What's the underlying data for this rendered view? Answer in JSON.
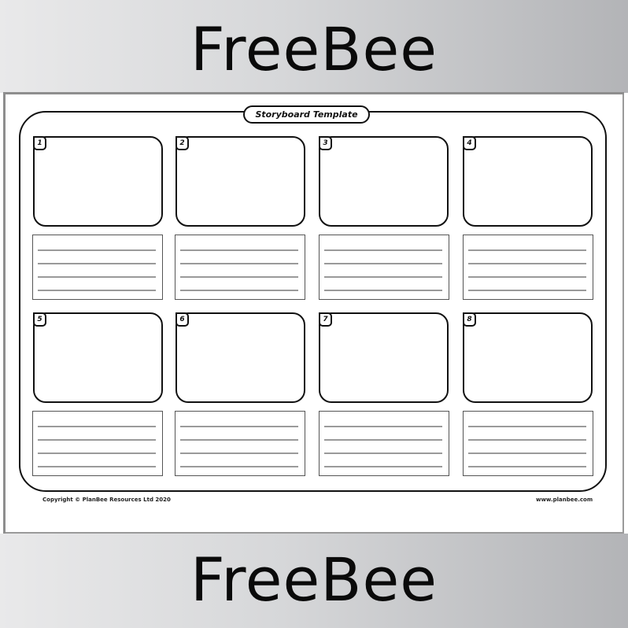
{
  "banner": {
    "top_text": "FreeBee",
    "bottom_text": "FreeBee"
  },
  "worksheet": {
    "title": "Storyboard Template",
    "panels": [
      {
        "number": "1"
      },
      {
        "number": "2"
      },
      {
        "number": "3"
      },
      {
        "number": "4"
      },
      {
        "number": "5"
      },
      {
        "number": "6"
      },
      {
        "number": "7"
      },
      {
        "number": "8"
      }
    ],
    "caption_lines_per_panel": 4,
    "copyright": "Copyright © PlanBee Resources Ltd 2020",
    "website": "www.planbee.com"
  },
  "colors": {
    "ink": "#111111",
    "caption_line": "#9a9a9a",
    "band_light": "#e9e9ea",
    "band_dark": "#b3b4b7"
  }
}
